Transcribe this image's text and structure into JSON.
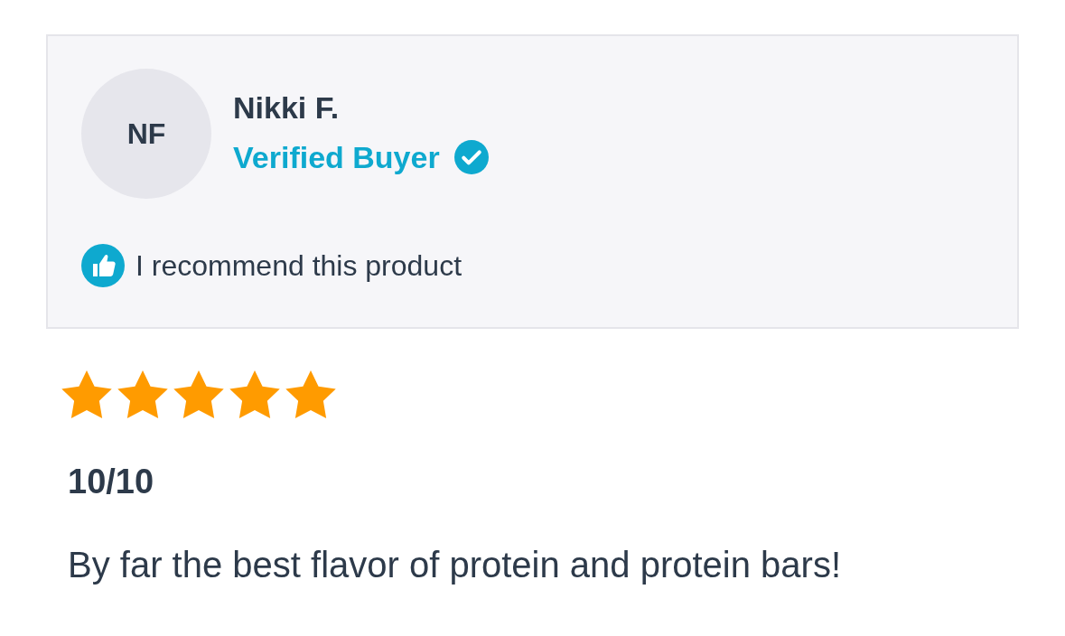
{
  "reviewer": {
    "initials": "NF",
    "name": "Nikki F.",
    "badge": "Verified Buyer",
    "verified": true
  },
  "recommendation": {
    "recommended": true,
    "text": "I recommend this product"
  },
  "review": {
    "stars": 5,
    "title": "10/10",
    "body": "By far the best flavor of protein and protein bars!"
  }
}
